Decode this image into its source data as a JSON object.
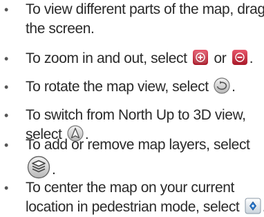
{
  "items": [
    {
      "lines": [
        "To view different parts of the map, drag",
        "the screen."
      ]
    },
    {
      "before": "To zoom in and out, select",
      "between": "or",
      "after": "."
    },
    {
      "before": "To rotate the map view, select",
      "after": "."
    },
    {
      "lines": [
        "To switch from North Up to 3D view,",
        "select"
      ],
      "after": "."
    },
    {
      "lines": [
        "To add or remove map layers, select"
      ],
      "after": "."
    },
    {
      "lines": [
        "To center the map on your current",
        "location in pedestrian mode, select"
      ],
      "after": "."
    }
  ],
  "bullet_char": "•",
  "icons": {
    "zoom_in": "zoom-in-icon",
    "zoom_out": "zoom-out-icon",
    "rotate": "rotate-icon",
    "compass": "compass-icon",
    "layers": "map-layers-icon",
    "center": "center-location-icon"
  },
  "colors": {
    "text": "#2a2a2a",
    "zoom_button": "#c42a3a",
    "icon_gray": "#8a8a8a",
    "center_button": "#2a7ad0"
  }
}
